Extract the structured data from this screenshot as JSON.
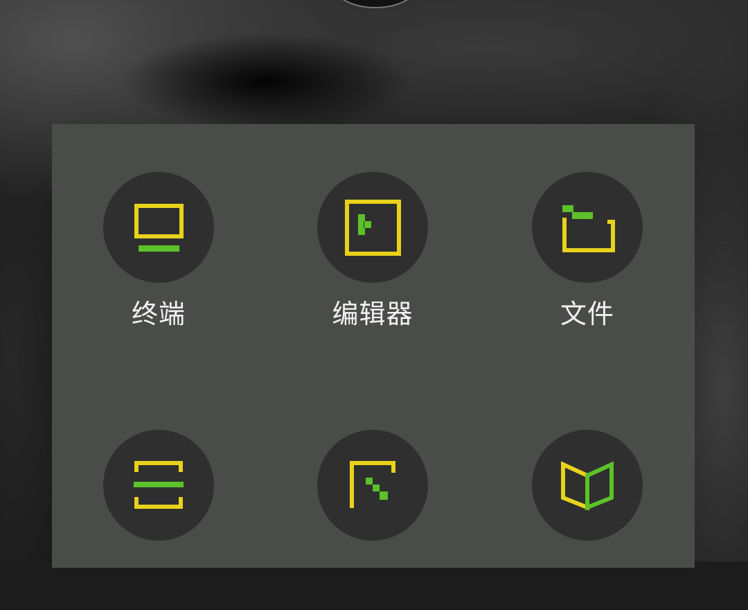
{
  "wallpaper": {
    "description_colors": [
      "#2a2a2a",
      "#161616"
    ]
  },
  "folder": {
    "background": "#4a4c4a",
    "apps": [
      {
        "label": "终端",
        "icon": "terminal-icon"
      },
      {
        "label": "编辑器",
        "icon": "editor-icon"
      },
      {
        "label": "文件",
        "icon": "files-icon"
      },
      {
        "label": "",
        "icon": "scan-icon"
      },
      {
        "label": "",
        "icon": "resize-icon"
      },
      {
        "label": "",
        "icon": "book-icon"
      }
    ]
  },
  "colors": {
    "icon_yellow": "#e8d21c",
    "icon_green": "#5cc12a",
    "icon_bg": "#2e2f2e",
    "label": "#f2f2f2"
  }
}
